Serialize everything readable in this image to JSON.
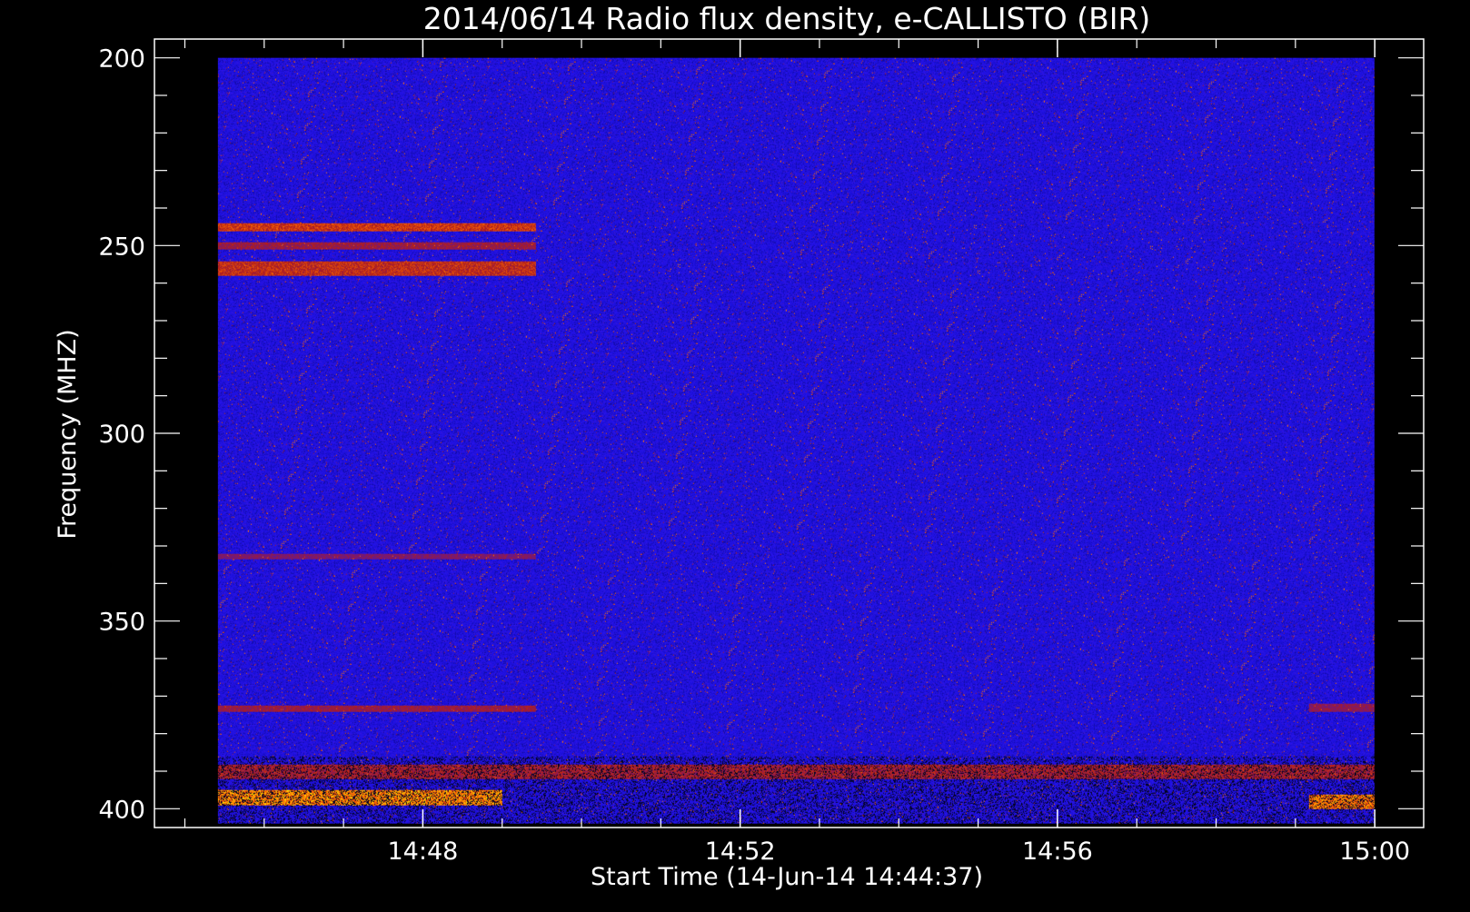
{
  "chart_data": {
    "type": "heatmap",
    "title": "2014/06/14  Radio flux density, e-CALLISTO (BIR)",
    "xlabel": "Start Time (14-Jun-14 14:44:37)",
    "ylabel": "Frequency (MHZ)",
    "x_unit": "time (HH:MM)",
    "xlim": [
      "14:44:37",
      "15:00:37"
    ],
    "ylim": [
      405,
      195
    ],
    "x_ticks": [
      {
        "label": "14:48",
        "value": "14:48"
      },
      {
        "label": "14:52",
        "value": "14:52"
      },
      {
        "label": "14:56",
        "value": "14:56"
      },
      {
        "label": "15:00",
        "value": "15:00"
      }
    ],
    "y_ticks": [
      {
        "label": "200",
        "value": 200
      },
      {
        "label": "250",
        "value": 250
      },
      {
        "label": "300",
        "value": 300
      },
      {
        "label": "350",
        "value": 350
      },
      {
        "label": "400",
        "value": 400
      }
    ],
    "data_extent": {
      "t_start": "14:45:25",
      "t_end": "15:00:00",
      "f_min": 200,
      "f_max": 404
    },
    "colormap": [
      "#000000",
      "#1a0fd6",
      "#b01c1c",
      "#ff6a00",
      "#ffe600"
    ],
    "background_color": "#2a14e0",
    "features": [
      {
        "name": "",
        "t_start": "14:45:25",
        "t_end": "14:49:25",
        "f_low": 244,
        "f_high": 246,
        "intensity": 0.75
      },
      {
        "name": "",
        "t_start": "14:45:25",
        "t_end": "14:49:25",
        "f_low": 249,
        "f_high": 251,
        "intensity": 0.55
      },
      {
        "name": "",
        "t_start": "14:45:25",
        "t_end": "14:49:25",
        "f_low": 254,
        "f_high": 258,
        "intensity": 0.7
      },
      {
        "name": "",
        "t_start": "14:45:25",
        "t_end": "14:49:25",
        "f_low": 332,
        "f_high": 333.5,
        "intensity": 0.45
      },
      {
        "name": "",
        "t_start": "14:45:25",
        "t_end": "14:49:25",
        "f_low": 372.5,
        "f_high": 374,
        "intensity": 0.55
      },
      {
        "name": "",
        "t_start": "14:45:25",
        "t_end": "14:49:00",
        "f_low": 395,
        "f_high": 399,
        "intensity": 1.0
      },
      {
        "name": "",
        "t_start": "14:45:25",
        "t_end": "15:00:00",
        "f_low": 388,
        "f_high": 392,
        "intensity": 0.6
      },
      {
        "name": "",
        "t_start": "14:59:10",
        "t_end": "15:00:00",
        "f_low": 396,
        "f_high": 400,
        "intensity": 0.95
      },
      {
        "name": "",
        "t_start": "14:59:10",
        "t_end": "15:00:00",
        "f_low": 372,
        "f_high": 374,
        "intensity": 0.5
      }
    ]
  }
}
